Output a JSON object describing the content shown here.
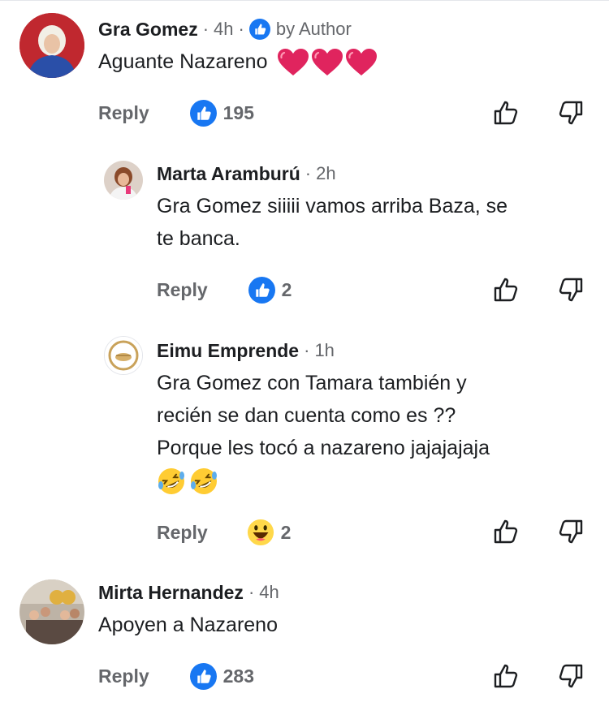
{
  "comments": [
    {
      "name": "Gra Gomez",
      "time": "4h",
      "badge": "by Author",
      "text": "Aguante Nazareno",
      "emoji": [
        "red-heart",
        "red-heart",
        "red-heart"
      ],
      "reply_label": "Reply",
      "reaction_icon": "like-icon",
      "reaction_count": "195"
    },
    {
      "name": "Marta Aramburú",
      "time": "2h",
      "text_lines": [
        "Gra Gomez siiiii vamos arriba Baza, se",
        "te banca."
      ],
      "reply_label": "Reply",
      "reaction_icon": "like-icon",
      "reaction_count": "2"
    },
    {
      "name": "Eimu Emprende",
      "time": "1h",
      "text_lines": [
        "Gra Gomez con Tamara también y",
        "recién se dan cuenta como es ??",
        "Porque les tocó a nazareno jajajajaja"
      ],
      "emoji": [
        "rolling-laughing",
        "rolling-laughing"
      ],
      "reply_label": "Reply",
      "reaction_icon": "haha-icon",
      "reaction_count": "2"
    },
    {
      "name": "Mirta Hernandez",
      "time": "4h",
      "text": "Apoyen a Nazareno",
      "reply_label": "Reply",
      "reaction_icon": "like-icon",
      "reaction_count": "283"
    }
  ],
  "colors": {
    "like_blue": "#1877f2",
    "meta_gray": "#65676b",
    "heart_red": "#e0245e"
  }
}
